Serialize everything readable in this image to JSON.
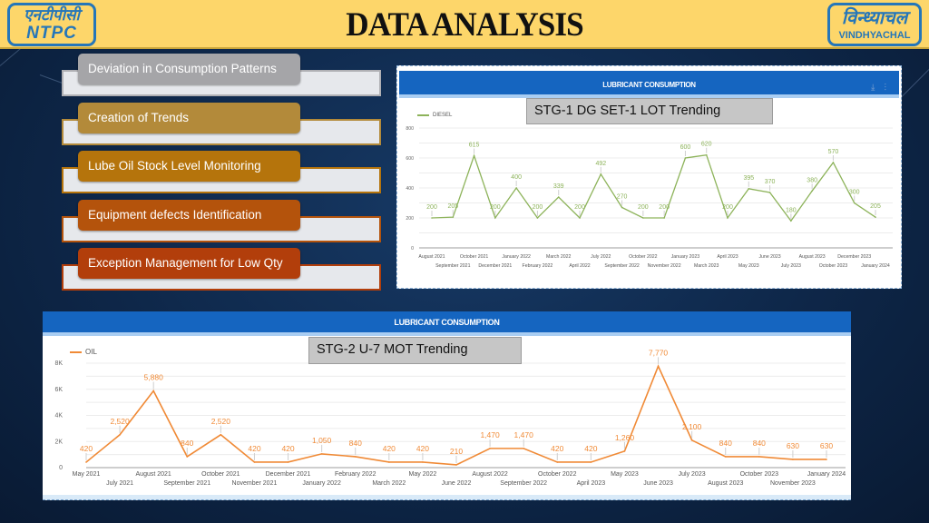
{
  "header": {
    "title": "DATA ANALYSIS",
    "logo_left": {
      "hindi": "एनटीपीसी",
      "english": "NTPC"
    },
    "logo_right": {
      "hindi": "विन्ध्याचल",
      "english": "VINDHYACHAL"
    },
    "background_color": "#fdd66a"
  },
  "features": [
    {
      "label": "Deviation in Consumption Patterns",
      "color": "#a5a5a8"
    },
    {
      "label": "Creation of Trends",
      "color": "#b38a3a"
    },
    {
      "label": "Lube Oil Stock Level Monitoring",
      "color": "#b5740c"
    },
    {
      "label": "Equipment defects Identification",
      "color": "#b4530c"
    },
    {
      "label": "Exception Management for Low Qty",
      "color": "#b23e0b"
    }
  ],
  "panels": {
    "top": {
      "header": "LUBRICANT CONSUMPTION",
      "callout": "STG-1 DG SET-1 LOT Trending",
      "legend": "DIESEL"
    },
    "bottom": {
      "header": "LUBRICANT CONSUMPTION",
      "callout": "STG-2 U-7 MOT Trending",
      "legend": "OIL"
    }
  },
  "chart_data": [
    {
      "type": "line",
      "title": "LUBRICANT CONSUMPTION",
      "annotation": "STG-1 DG SET-1 LOT Trending",
      "color": "#8db35a",
      "legend": "top-left",
      "grid": true,
      "categories": [
        "August 2021",
        "September 2021",
        "October 2021",
        "December 2021",
        "January 2022",
        "February 2022",
        "March 2022",
        "April 2022",
        "July 2022",
        "September 2022",
        "October 2022",
        "November 2022",
        "January 2023",
        "March 2023",
        "April 2023",
        "May 2023",
        "June 2023",
        "July 2023",
        "August 2023",
        "October 2023",
        "December 2023",
        "January 2024"
      ],
      "series": [
        {
          "name": "DIESEL",
          "values": [
            200,
            205,
            615,
            200,
            400,
            200,
            339,
            200,
            492,
            270,
            200,
            200,
            600,
            620,
            200,
            395,
            370,
            180,
            380,
            570,
            300,
            205
          ]
        }
      ],
      "yticks": [
        "0",
        "200",
        "400",
        "600",
        "800"
      ],
      "ylim": [
        0,
        800
      ]
    },
    {
      "type": "line",
      "title": "LUBRICANT CONSUMPTION",
      "annotation": "STG-2 U-7 MOT Trending",
      "color": "#f08a36",
      "legend": "top-left",
      "grid": true,
      "categories": [
        "May 2021",
        "July 2021",
        "August 2021",
        "September 2021",
        "October 2021",
        "November 2021",
        "December 2021",
        "January 2022",
        "February 2022",
        "March 2022",
        "May 2022",
        "June 2022",
        "August 2022",
        "September 2022",
        "October 2022",
        "April 2023",
        "May 2023",
        "June 2023",
        "July 2023",
        "August 2023",
        "October 2023",
        "November 2023",
        "January 2024"
      ],
      "series": [
        {
          "name": "OIL",
          "values": [
            420,
            2520,
            5880,
            840,
            2520,
            420,
            420,
            1050,
            840,
            420,
            420,
            210,
            1470,
            1470,
            420,
            420,
            1260,
            7770,
            2100,
            840,
            840,
            630,
            630
          ]
        }
      ],
      "value_labels": [
        "420",
        "2,520",
        "5,880",
        "840",
        "2,520",
        "420",
        "420",
        "1,050",
        "840",
        "420",
        "420",
        "210",
        "1,470",
        "1,470",
        "420",
        "420",
        "1,260",
        "7,770",
        "2,100",
        "840",
        "840",
        "630",
        "630"
      ],
      "yticks": [
        "0",
        "2K",
        "4K",
        "6K",
        "8K"
      ],
      "ylim": [
        0,
        8000
      ]
    }
  ]
}
